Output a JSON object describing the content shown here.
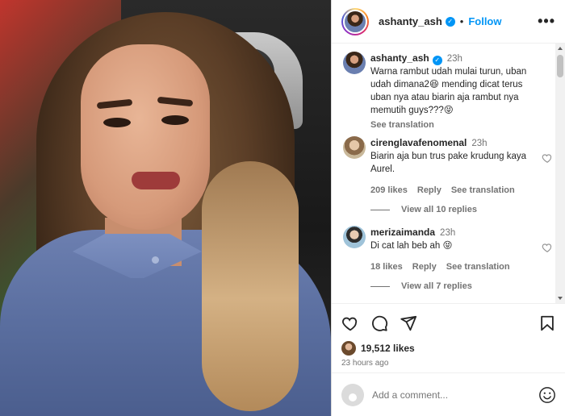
{
  "post": {
    "username": "ashanty_ash",
    "follow_label": "Follow",
    "dot": "•",
    "more_label": "•••"
  },
  "caption": {
    "username": "ashanty_ash",
    "time": "23h",
    "text": "Warna rambut udah mulai turun, uban udah dimana2😆 mending dicat terus uban nya atau biarin aja rambut nya memutih guys???😝",
    "see_translation": "See translation"
  },
  "comments": [
    {
      "username": "cirenglavafenomenal",
      "time": "23h",
      "text": "Biarin aja bun trus pake krudung kaya Aurel.",
      "likes": "209 likes",
      "reply": "Reply",
      "see_translation": "See translation",
      "view_replies": "View all 10 replies"
    },
    {
      "username": "merizaimanda",
      "time": "23h",
      "text": "Di cat lah beb ah 😝",
      "likes": "18 likes",
      "reply": "Reply",
      "see_translation": "See translation",
      "view_replies": "View all 7 replies"
    }
  ],
  "engagement": {
    "likes": "19,512 likes",
    "posted_ago": "23 hours ago"
  },
  "composer": {
    "placeholder": "Add a comment..."
  },
  "icons": {
    "like": "heart-icon",
    "comment": "comment-icon",
    "share": "share-icon",
    "save": "bookmark-icon",
    "emoji": "emoji-icon",
    "verified": "verified-badge-icon"
  },
  "colors": {
    "accent": "#0095f6",
    "text": "#262626",
    "muted": "#737373"
  }
}
